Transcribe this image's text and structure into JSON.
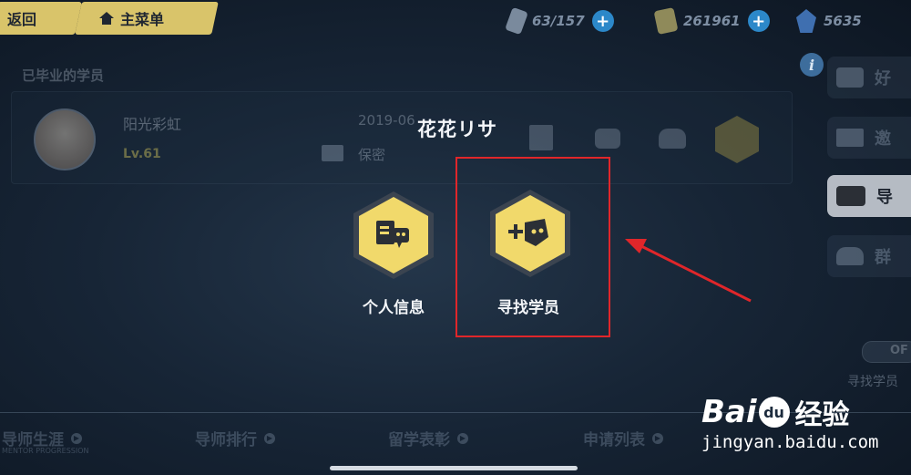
{
  "topbar": {
    "back_label": "返回",
    "main_menu_label": "主菜单",
    "resources": [
      {
        "icon": "phone-icon",
        "value": "63/157"
      },
      {
        "icon": "crystal-icon",
        "value": "261961"
      },
      {
        "icon": "gem-icon",
        "value": "5635"
      }
    ]
  },
  "section_title": "已毕业的学员",
  "student": {
    "name": "阳光彩虹",
    "level": "Lv.61",
    "date_partial": "2019-06",
    "privacy": "保密"
  },
  "dialog": {
    "player_name": "花花リサ",
    "actions": [
      {
        "icon": "profile-card-icon",
        "label": "个人信息"
      },
      {
        "icon": "add-student-icon",
        "label": "寻找学员"
      }
    ]
  },
  "right_tabs": [
    "好",
    "邀",
    "导",
    "群"
  ],
  "toggle_label": "OF",
  "find_student_partial": "寻找学员",
  "bottom_tabs": {
    "career": "导师生涯",
    "career_sub": "MENTOR PROGRESSION",
    "ranking": "导师排行",
    "study_abroad": "留学表彰",
    "requests": "申请列表"
  },
  "watermark": {
    "brand": "Bai",
    "brand2": "du",
    "product": "经验",
    "url": "jingyan.baidu.com"
  },
  "colors": {
    "accent_yellow": "#f1d96b",
    "highlight_red": "#e0262a",
    "plus_blue": "#2c88c9"
  }
}
